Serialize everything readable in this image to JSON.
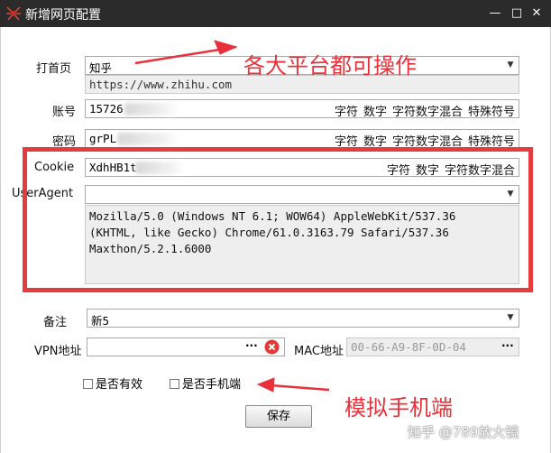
{
  "window": {
    "title": "新增网页配置"
  },
  "homepage": {
    "label": "打首页",
    "value": "知乎",
    "url": "https://www.zhihu.com"
  },
  "account": {
    "label": "账号",
    "value": "15726"
  },
  "password": {
    "label": "密码",
    "value": "grPL"
  },
  "cookie": {
    "label": "Cookie",
    "value": "XdhHB1t"
  },
  "char_options": {
    "char": "字符",
    "digit": "数字",
    "mixed": "字符数字混合",
    "special": "特殊符号"
  },
  "useragent": {
    "label": "UserAgent",
    "value": "",
    "lines": [
      "Mozilla/5.0 (Windows NT 6.1; WOW64) AppleWebKit/537.36",
      "(KHTML, like Gecko) Chrome/61.0.3163.79 Safari/537.36",
      "Maxthon/5.2.1.6000"
    ]
  },
  "remark": {
    "label": "备注",
    "value": "新5"
  },
  "vpn": {
    "label": "VPN地址",
    "value": "",
    "browse": "···"
  },
  "mac": {
    "label": "MAC地址",
    "value": "00-66-A9-8F-0D-04",
    "browse": "···"
  },
  "checks": {
    "valid": "是否有效",
    "mobile": "是否手机端"
  },
  "save_label": "保存",
  "annotations": {
    "top": "各大平台都可操作",
    "bottom": "模拟手机端"
  },
  "watermark": "知乎 @789放大镜",
  "colors": {
    "annotation": "#e8313b",
    "titlebar": "#2b2b2b"
  }
}
